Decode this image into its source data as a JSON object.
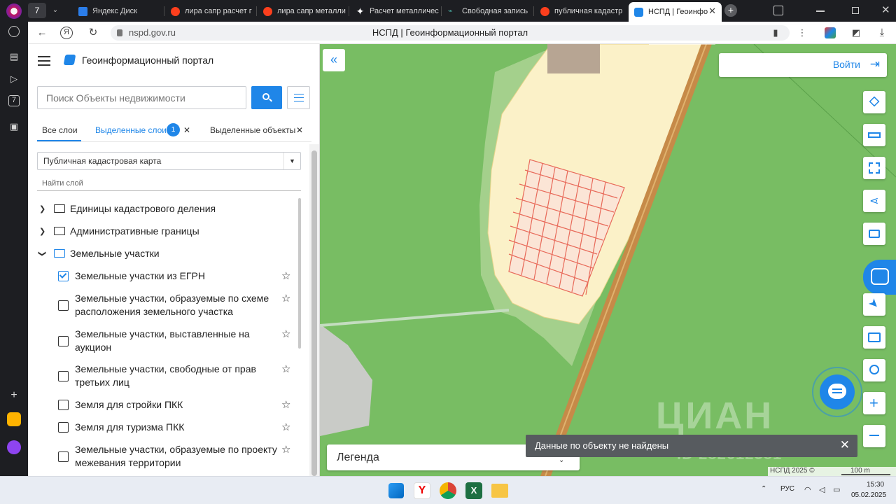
{
  "browser": {
    "tabs": [
      {
        "label": "Яндекс Диск",
        "fav_color": "#2b7de9"
      },
      {
        "label": "лира сапр расчет г",
        "fav_color": "#fc3f1d"
      },
      {
        "label": "лира сапр металли",
        "fav_color": "#fc3f1d"
      },
      {
        "label": "Расчет металличес",
        "fav_color": "#ffffff"
      },
      {
        "label": "Свободная запись",
        "fav_color": "#4ab0a6"
      },
      {
        "label": "публичная кадастр",
        "fav_color": "#fc3f1d"
      },
      {
        "label": "НСПД | Геоинфо",
        "fav_color": "#1f86e8"
      }
    ],
    "tab_counter": "7",
    "url": "nspd.gov.ru",
    "page_title": "НСПД | Геоинформационный портал"
  },
  "panel": {
    "title": "Геоинформационный портал",
    "search_placeholder": "Поиск Объекты недвижимости",
    "tabs": {
      "all_layers": "Все слои",
      "selected_layers": "Выделенные слои",
      "selected_layers_count": "1",
      "selected_objects": "Выделенные объекты"
    },
    "layer_select": "Публичная кадастровая карта",
    "find_layer_placeholder": "Найти слой",
    "folders": [
      {
        "label": "Единицы кадастрового деления",
        "expanded": false
      },
      {
        "label": "Административные границы",
        "expanded": false
      },
      {
        "label": "Земельные участки",
        "expanded": true
      }
    ],
    "layers": [
      {
        "label": "Земельные участки из ЕГРН",
        "checked": true
      },
      {
        "label": "Земельные участки, образуемые по схеме расположения земельного участка",
        "checked": false
      },
      {
        "label": "Земельные участки, выставленные на аукцион",
        "checked": false
      },
      {
        "label": "Земельные участки, свободные от прав третьих лиц",
        "checked": false
      },
      {
        "label": "Земля для стройки ПКК",
        "checked": false
      },
      {
        "label": "Земля для туризма ПКК",
        "checked": false
      },
      {
        "label": "Земельные участки, образуемые по проекту межевания территории",
        "checked": false
      }
    ]
  },
  "map": {
    "login_label": "Войти",
    "legend_label": "Легенда",
    "toast_text": "Данные по объекту не найдены",
    "scale_label": "100 m",
    "attribution": "НСПД 2025 ©",
    "watermark": "ЦИАН",
    "watermark_id": "ID 282612381",
    "colors": {
      "forest": "#78bd63",
      "parcel_fill": "#fbf1c8",
      "parcel_line": "#e86a5a",
      "road": "#c68a48"
    }
  },
  "taskbar": {
    "lang": "РУС",
    "time": "15:30",
    "date": "05.02.2025"
  }
}
